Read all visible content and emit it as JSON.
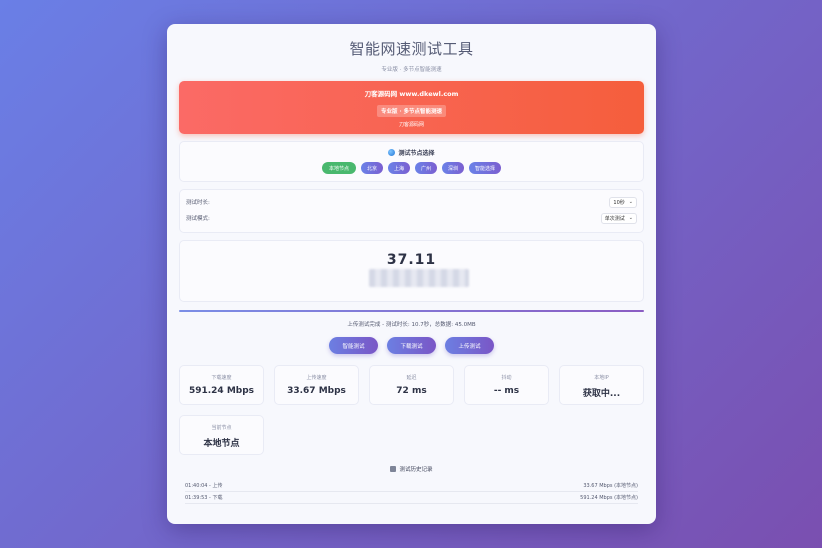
{
  "app": {
    "title": "智能网速测试工具",
    "subtitle": "专业版 · 多节点智能测速"
  },
  "banner": {
    "site": "刀客源码网 www.dkewl.com",
    "badge": "专业版 · 多节点智能测速",
    "link": "刀客源码网"
  },
  "nodes": {
    "heading": "测试节点选择",
    "items": [
      {
        "label": "本地节点",
        "active": true
      },
      {
        "label": "北京",
        "active": false
      },
      {
        "label": "上海",
        "active": false
      },
      {
        "label": "广州",
        "active": false
      },
      {
        "label": "深圳",
        "active": false
      },
      {
        "label": "智能选择",
        "active": false
      }
    ]
  },
  "settings": {
    "duration_label": "测试时长:",
    "duration_value": "10秒",
    "mode_label": "测试模式:",
    "mode_value": "单次测试"
  },
  "speed": {
    "value": "37.11"
  },
  "status": {
    "text": "上传测试完成 - 测试时长: 10.7秒，总数据: 45.0MB",
    "progress": 100
  },
  "actions": {
    "smart": "智能测试",
    "download": "下载测试",
    "upload": "上传测试"
  },
  "stats": {
    "download": {
      "label": "下载速度",
      "value": "591.24 Mbps"
    },
    "upload": {
      "label": "上传速度",
      "value": "33.67 Mbps"
    },
    "latency": {
      "label": "延迟",
      "value": "72 ms"
    },
    "jitter": {
      "label": "抖动",
      "value": "-- ms"
    },
    "local_ip": {
      "label": "本地IP",
      "value": "获取中..."
    },
    "current_node": {
      "label": "当前节点",
      "value": "本地节点"
    }
  },
  "history": {
    "heading": "测试历史记录",
    "rows": [
      {
        "time": "01:40:04 - 上传",
        "result": "33.67 Mbps (本地节点)"
      },
      {
        "time": "01:39:53 - 下载",
        "result": "591.24 Mbps (本地节点)"
      }
    ]
  },
  "colors": {
    "accent": "#6c7fe2",
    "banner": "#f55e3c",
    "active_node": "#49b86e"
  }
}
